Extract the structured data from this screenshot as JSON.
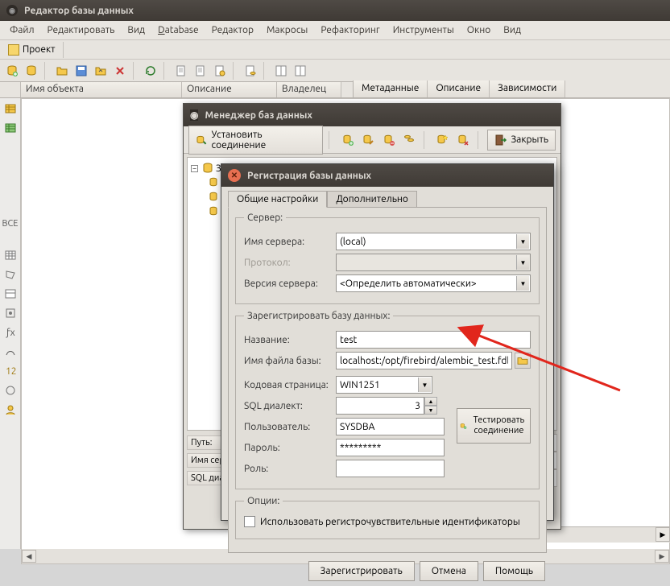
{
  "window": {
    "title": "Редактор базы данных"
  },
  "menu": {
    "file": "Файл",
    "edit": "Редактировать",
    "view": "Вид",
    "database": "Database",
    "editor": "Редактор",
    "macros": "Макросы",
    "refactoring": "Рефакторинг",
    "tools": "Инструменты",
    "window": "Окно",
    "view2": "Вид"
  },
  "project_tab": {
    "label": "Проект"
  },
  "columns": {
    "object_name": "Имя объекта",
    "description": "Описание",
    "owner": "Владелец"
  },
  "right_tabs": {
    "metadata": "Метаданные",
    "description": "Описание",
    "dependencies": "Зависимости"
  },
  "left_strip": {
    "all_label": "ВСЕ"
  },
  "dlg1": {
    "title": "Менеджер баз данных",
    "connect_btn": "Установить соединение",
    "close_btn": "Закрыть",
    "tree_root": "Зарегистрированные базы данных",
    "info": {
      "path": "Путь:",
      "server_name": "Имя серв",
      "sql_dial": "SQL диал"
    }
  },
  "dlg2": {
    "title": "Регистрация базы данных",
    "tabs": {
      "general": "Общие настройки",
      "advanced": "Дополнительно"
    },
    "server_group": "Сервер:",
    "server_name": "Имя сервера:",
    "server_name_val": "(local)",
    "protocol": "Протокол:",
    "server_version": "Версия сервера:",
    "server_version_val": "<Определить автоматически>",
    "register_group": "Зарегистрировать базу данных:",
    "name": "Название:",
    "name_val": "test",
    "db_file": "Имя файла базы:",
    "db_file_val": "localhost:/opt/firebird/alembic_test.fdb",
    "codepage": "Кодовая страница:",
    "codepage_val": "WIN1251",
    "sql_dialect": "SQL диалект:",
    "sql_dialect_val": "3",
    "user": "Пользователь:",
    "user_val": "SYSDBA",
    "password": "Пароль:",
    "password_val": "*********",
    "role": "Роль:",
    "role_val": "",
    "options_group": "Опции:",
    "case_sensitive": "Использовать регистрочувствительные идентификаторы",
    "test_btn": "Тестировать соединение",
    "register_btn": "Зарегистрировать",
    "cancel_btn": "Отмена",
    "help_btn": "Помощь"
  }
}
